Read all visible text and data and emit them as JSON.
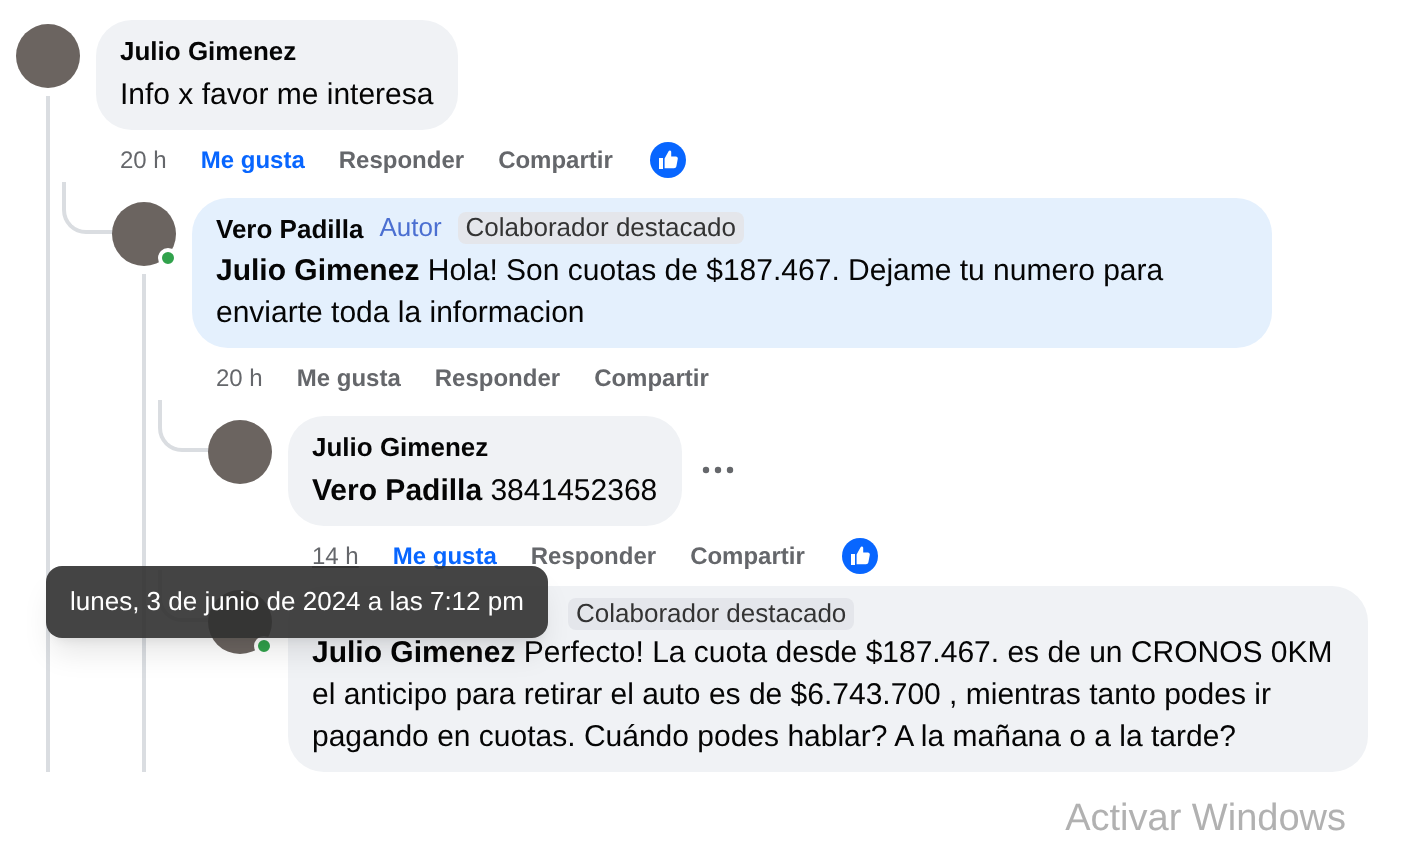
{
  "comments": [
    {
      "author": "Julio Gimenez",
      "highlighted": false,
      "text": "Info x favor me interesa",
      "time": "20 h",
      "time_hovered": false,
      "like_label": "Me gusta",
      "liked": true,
      "reply_label": "Responder",
      "share_label": "Compartir",
      "has_reaction": true,
      "children": [
        {
          "author": "Vero Padilla",
          "online": true,
          "highlighted": true,
          "badges": [
            {
              "kind": "author",
              "text": "Autor"
            },
            {
              "kind": "top_fan",
              "text": "Colaborador destacado"
            }
          ],
          "text": "**Julio Gimenez** Hola! Son cuotas de $187.467. Dejame tu numero para enviarte toda la informacion",
          "time": "20 h",
          "time_hovered": false,
          "like_label": "Me gusta",
          "liked": false,
          "reply_label": "Responder",
          "share_label": "Compartir",
          "children": [
            {
              "author": "Julio Gimenez",
              "highlighted": false,
              "text": "**Vero Padilla** 3841452368",
              "time": "14 h",
              "time_hovered": true,
              "like_label": "Me gusta",
              "liked": true,
              "reply_label": "Responder",
              "share_label": "Compartir",
              "has_reaction": true,
              "has_more_button": true
            },
            {
              "online": true,
              "highlighted": false,
              "badges": [
                {
                  "kind": "top_fan",
                  "text": "Colaborador destacado"
                }
              ],
              "text": "**Julio Gimenez** Perfecto! La cuota desde $187.467. es de un CRONOS 0KM el anticipo para retirar el auto es de $6.743.700 , mientras tanto podes ir pagando en cuotas. Cuándo podes hablar? A la mañana o a la tarde?"
            }
          ]
        }
      ]
    }
  ],
  "tooltip": "lunes, 3 de junio de 2024 a las 7:12 pm",
  "os_notice": "Activar Windows"
}
